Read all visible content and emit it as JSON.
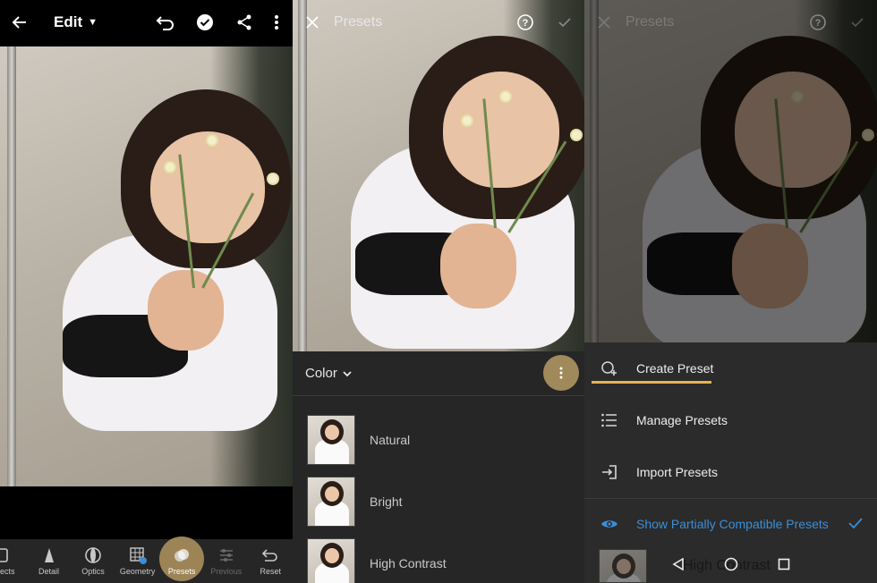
{
  "panel1": {
    "title": "Edit",
    "toolbar": [
      {
        "label": "ects",
        "icon": "effects-icon"
      },
      {
        "label": "Detail",
        "icon": "detail-icon"
      },
      {
        "label": "Optics",
        "icon": "optics-icon"
      },
      {
        "label": "Geometry",
        "icon": "geometry-icon"
      },
      {
        "label": "Presets",
        "icon": "presets-icon",
        "active": true
      },
      {
        "label": "Previous",
        "icon": "previous-icon",
        "disabled": true
      },
      {
        "label": "Reset",
        "icon": "reset-icon"
      }
    ]
  },
  "panel2": {
    "title": "Presets",
    "group_label": "Color",
    "presets": [
      "Natural",
      "Bright",
      "High Contrast"
    ]
  },
  "panel3": {
    "title": "Presets",
    "menu": {
      "create": "Create Preset",
      "manage": "Manage Presets",
      "import": "Import Presets",
      "show_partial": "Show Partially Compatible Presets"
    },
    "behind_item": "High Contrast"
  },
  "colors": {
    "accent_gold": "#9d8456",
    "underline": "#e8b252",
    "blue": "#3b8ed8"
  }
}
